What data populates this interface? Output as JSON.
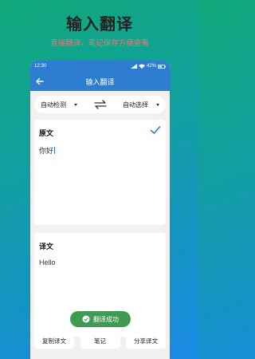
{
  "promo": {
    "title": "输入翻译",
    "subtitle": "直接翻译，笔记保存方便查看"
  },
  "status_bar": {
    "time": "12:30",
    "right_text": "42%"
  },
  "app_bar": {
    "title": "输入翻译",
    "back_icon": "arrow-left-icon"
  },
  "language_bar": {
    "source_language": "自动检测",
    "target_language": "自动选择",
    "swap_icon": "swap-arrows-icon"
  },
  "source": {
    "title": "原文",
    "text": "你好",
    "confirm_icon": "check-icon"
  },
  "target": {
    "title": "译文",
    "text": "Hello"
  },
  "toast": {
    "text": "翻译成功",
    "icon": "check-circle-icon",
    "color": "#3f9a52"
  },
  "bottom_buttons": [
    {
      "label": "复制译文"
    },
    {
      "label": "笔记"
    },
    {
      "label": "分享译文"
    }
  ],
  "colors": {
    "primary": "#2e7dd1",
    "accent_text": "#e07a76"
  }
}
